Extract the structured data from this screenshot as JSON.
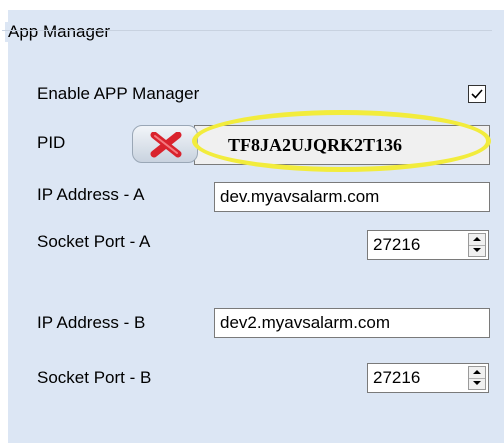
{
  "group": {
    "title": "App Manager"
  },
  "enable": {
    "label": "Enable APP Manager",
    "checked": true
  },
  "pid": {
    "label": "PID",
    "value": "TF8JA2UJQRK2T136",
    "clear_icon": "red-x-icon"
  },
  "ip_a": {
    "label": "IP Address  - A",
    "value": "dev.myavsalarm.com"
  },
  "port_a": {
    "label": "Socket Port - A",
    "value": "27216"
  },
  "ip_b": {
    "label": "IP Address - B",
    "value": "dev2.myavsalarm.com"
  },
  "port_b": {
    "label": "Socket Port - B",
    "value": "27216"
  },
  "colors": {
    "panel_bg": "#dce6f4",
    "highlight": "#f2ec3c",
    "clear_x": "#d9232d"
  }
}
